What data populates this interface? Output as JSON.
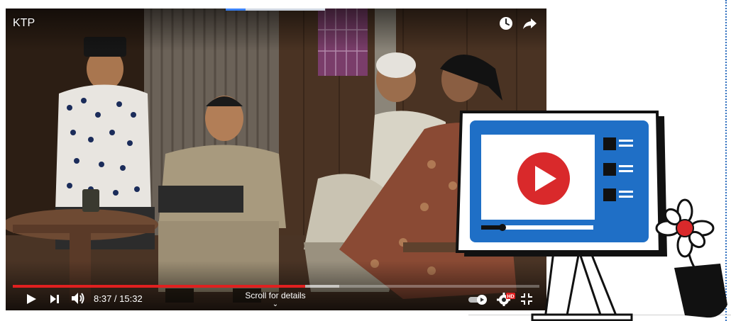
{
  "video": {
    "title": "KTP",
    "current_time": "8:37",
    "duration": "15:32",
    "time_separator": " / ",
    "played_fraction": 0.555,
    "buffered_fraction": 0.62,
    "scroll_hint": "Scroll for details",
    "scroll_chevron": "⌄",
    "quality_badge": "HD",
    "icons": {
      "watch_later": "clock-icon",
      "share": "share-arrow-icon",
      "play": "play-icon",
      "next": "skip-next-icon",
      "volume": "volume-icon",
      "autoplay": "autoplay-toggle-icon",
      "settings": "settings-gear-icon",
      "exit_fullscreen": "exit-fullscreen-icon"
    }
  },
  "colors": {
    "progress_played": "#e02020",
    "illustration_blue": "#1f6fc6",
    "play_red": "#d9292b",
    "flower_red": "#d9292b"
  }
}
